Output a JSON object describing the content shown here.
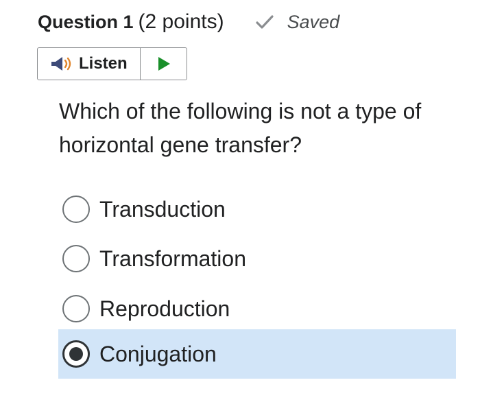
{
  "question": {
    "title": "Question 1",
    "points": "(2 points)",
    "status": "Saved",
    "status_icon": "check-icon",
    "text": "Which of the following is not a type of horizontal gene transfer?"
  },
  "listen": {
    "label": "Listen",
    "speaker_icon": "speaker-icon",
    "play_icon": "play-icon",
    "play_color": "#1a8f2a"
  },
  "options": [
    {
      "label": "Transduction",
      "selected": false
    },
    {
      "label": "Transformation",
      "selected": false
    },
    {
      "label": "Reproduction",
      "selected": false
    },
    {
      "label": "Conjugation",
      "selected": true
    }
  ],
  "colors": {
    "selected_background": "#d2e5f8",
    "text": "#202122",
    "saved_text": "#494c4e"
  }
}
